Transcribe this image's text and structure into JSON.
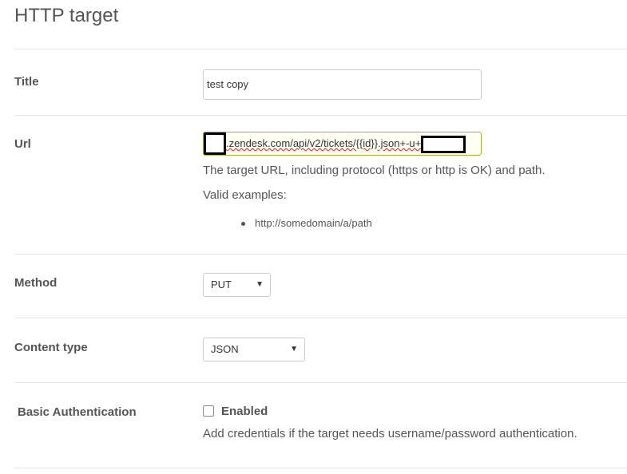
{
  "header": {
    "title": "HTTP target"
  },
  "title_field": {
    "label": "Title",
    "value": "test copy"
  },
  "url_field": {
    "label": "Url",
    "value_visible": ".zendesk.com/api/v2/tickets/{{id}}.json+-u+",
    "help": "The target URL, including protocol (https or http is OK) and path.",
    "examples_label": "Valid examples:",
    "examples": [
      "http://somedomain/a/path"
    ]
  },
  "method_field": {
    "label": "Method",
    "value": "PUT"
  },
  "content_type_field": {
    "label": "Content type",
    "value": "JSON"
  },
  "basic_auth": {
    "label": "Basic Authentication",
    "checkbox_label": "Enabled",
    "checked": false,
    "help": "Add credentials if the target needs username/password authentication."
  },
  "icons": {
    "dropdown": "chevron-down-icon"
  },
  "colors": {
    "url_border": "#99b832",
    "divider": "#e6e6e6",
    "text": "#555555"
  }
}
